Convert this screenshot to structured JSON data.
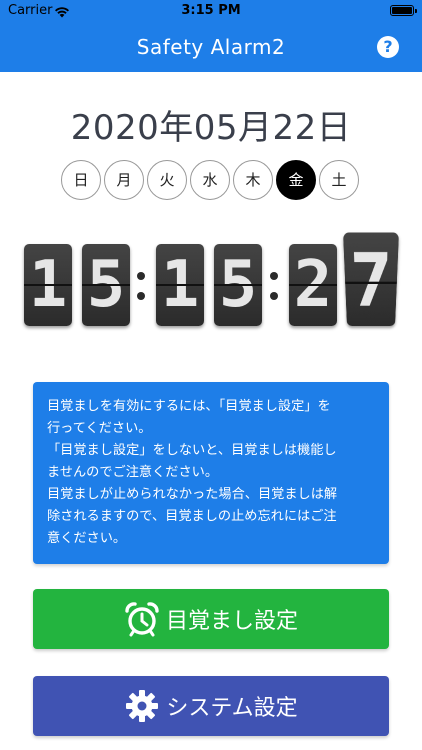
{
  "status_bar": {
    "carrier": "Carrier",
    "time": "3:15 PM"
  },
  "nav": {
    "title": "Safety Alarm2",
    "help_label": "?"
  },
  "date": "2020年05月22日",
  "weekdays": [
    "日",
    "月",
    "火",
    "水",
    "木",
    "金",
    "土"
  ],
  "active_weekday": "金",
  "clock": {
    "h1": "1",
    "h2": "5",
    "m1": "1",
    "m2": "5",
    "s1": "2",
    "s2": "7"
  },
  "notice": {
    "line1": "目覚ましを有効にするには、「目覚まし設定」を",
    "line2": "行ってください。",
    "line3": "「目覚まし設定」をしないと、目覚ましは機能し",
    "line4": "ませんのでご注意ください。",
    "line5": "目覚ましが止められなかった場合、目覚ましは解",
    "line6": "除されるますので、目覚ましの止め忘れにはご注",
    "line7": "意ください。"
  },
  "buttons": {
    "alarm_settings": "目覚まし設定",
    "system_settings": "システム設定"
  },
  "colors": {
    "header_blue": "#1e7ee8",
    "alarm_green": "#23b43f",
    "system_indigo": "#4053b3"
  },
  "icons": {
    "alarm": "alarm-clock-icon",
    "system": "gear-icon",
    "help": "help-circle-icon"
  }
}
